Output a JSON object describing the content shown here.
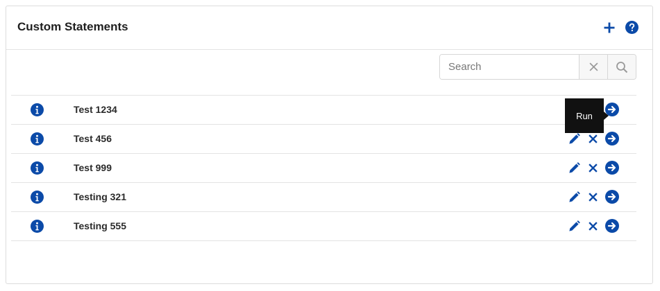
{
  "panel": {
    "title": "Custom Statements",
    "add_icon": "plus-icon",
    "help_icon": "question-circle-icon"
  },
  "search": {
    "placeholder": "Search",
    "value": "",
    "clear_icon": "close-icon",
    "search_icon": "magnifier-icon"
  },
  "statements": [
    {
      "name": "Test 1234"
    },
    {
      "name": "Test 456"
    },
    {
      "name": "Test 999"
    },
    {
      "name": "Testing 321"
    },
    {
      "name": "Testing 555"
    }
  ],
  "row_icons": {
    "info": "info-circle-icon",
    "edit": "pencil-icon",
    "delete": "close-icon",
    "run": "arrow-circle-right-icon"
  },
  "tooltip": {
    "text": "Run"
  },
  "colors": {
    "accent": "#0b4aa8",
    "muted_icon": "#9a9a9a",
    "tooltip_bg": "#111111"
  }
}
